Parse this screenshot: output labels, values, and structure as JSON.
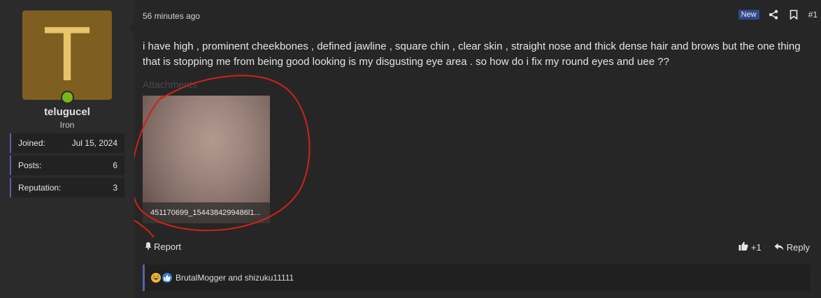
{
  "user": {
    "avatar_letter": "T",
    "avatar_color": "#7f5f21",
    "online_color": "#7cb518",
    "username": "telugucel",
    "title": "Iron",
    "stats": [
      {
        "label": "Joined:",
        "value": "Jul 15, 2024"
      },
      {
        "label": "Posts:",
        "value": "6"
      },
      {
        "label": "Reputation:",
        "value": "3"
      }
    ]
  },
  "post": {
    "time": "56 minutes ago",
    "badge": "New",
    "number": "#1",
    "text": "i have high , prominent cheekbones , defined jawline , square chin , clear skin , straight nose and thick dense hair and brows but the one thing that is stopping me from being good looking is my disgusting eye area . so how do i fix my round eyes and uee ??",
    "attachments_label": "Attachments",
    "attachment_name": "451170699_1544384299486l1...",
    "report_label": "Report",
    "like_label": "+1",
    "reply_label": "Reply",
    "reactions_text": "BrutalMogger and shizuku11111",
    "icons": [
      "share-icon",
      "bookmark-icon",
      "bell-icon",
      "thumbs-up-icon",
      "reply-icon",
      "laugh-emoji-icon",
      "like-reaction-icon"
    ],
    "accent_color": "#5a62a8",
    "badge_color": "#2f4a88",
    "annotation_color": "#d0221c"
  }
}
